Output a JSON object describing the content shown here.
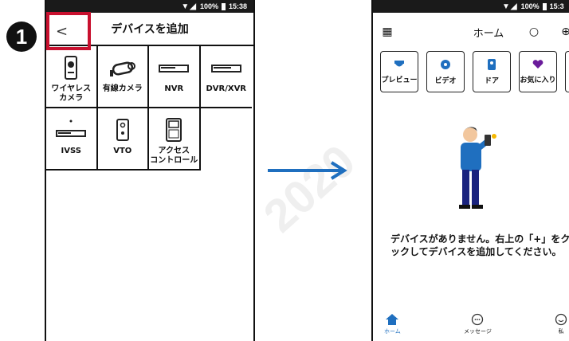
{
  "step_number": "1",
  "watermark": "2020",
  "left_screen": {
    "status": {
      "battery": "100%",
      "time": "15:38"
    },
    "title": "デバイスを追加",
    "back_label": "<",
    "devices": [
      {
        "label": "ワイヤレス\nカメラ",
        "icon": "wireless-camera-icon"
      },
      {
        "label": "有線カメラ",
        "icon": "bullet-camera-icon"
      },
      {
        "label": "NVR",
        "icon": "nvr-icon"
      },
      {
        "label": "DVR/XVR",
        "icon": "dvr-icon"
      },
      {
        "label": "IVSS",
        "icon": "ivss-icon"
      },
      {
        "label": "VTO",
        "icon": "vto-icon"
      },
      {
        "label": "アクセス\nコントロール",
        "icon": "access-control-icon"
      }
    ]
  },
  "right_screen": {
    "status": {
      "battery": "100%",
      "time": "15:3"
    },
    "title": "ホーム",
    "tabs": [
      {
        "label": "プレビュー",
        "icon": "preview-icon"
      },
      {
        "label": "ビデオ",
        "icon": "video-icon"
      },
      {
        "label": "ドア",
        "icon": "door-icon"
      },
      {
        "label": "お気に入り",
        "icon": "heart-icon"
      }
    ],
    "empty_message": "デバイスがありません。右上の「+」をクリックしてデバイスを追加してください。",
    "nav": [
      {
        "label": "ホーム",
        "icon": "home-icon"
      },
      {
        "label": "メッセージ",
        "icon": "message-icon"
      },
      {
        "label": "私",
        "icon": "me-icon"
      }
    ]
  },
  "colors": {
    "accent": "#1f6fbf",
    "highlight": "#c8102e",
    "heart": "#6a1b9a"
  }
}
